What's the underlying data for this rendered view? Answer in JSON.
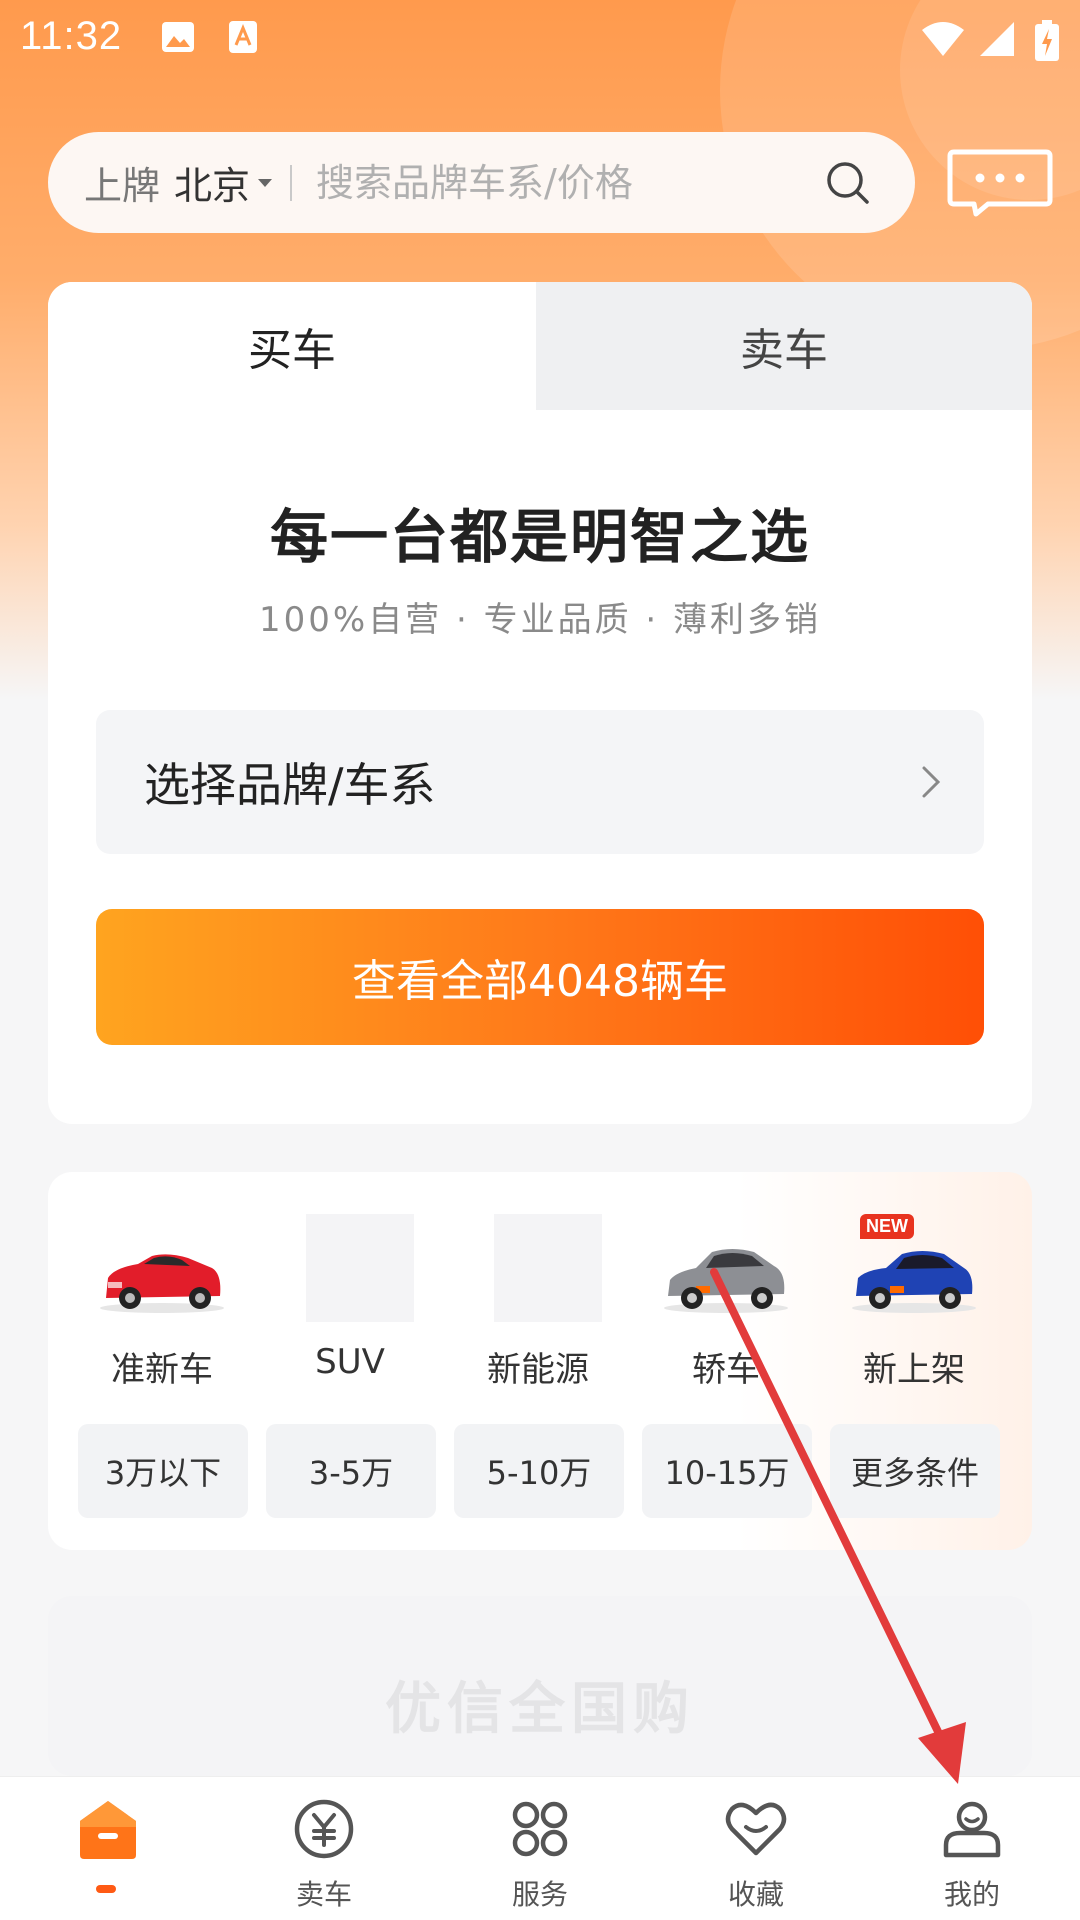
{
  "status_bar": {
    "time": "11:32"
  },
  "search": {
    "prefix": "上牌",
    "city": "北京",
    "placeholder": "搜索品牌车系/价格"
  },
  "tabs": [
    {
      "label": "买车",
      "active": true
    },
    {
      "label": "卖车",
      "active": false
    }
  ],
  "hero": {
    "headline": "每一台都是明智之选",
    "subline": "100%自营 · 专业品质 · 薄利多销"
  },
  "brand_select": {
    "label": "选择品牌/车系"
  },
  "cta": {
    "label": "查看全部4048辆车"
  },
  "categories": [
    {
      "label": "准新车",
      "icon": "red-convertible-car-image"
    },
    {
      "label": "SUV",
      "icon": "placeholder-image"
    },
    {
      "label": "新能源",
      "icon": "placeholder-image"
    },
    {
      "label": "轿车",
      "icon": "silver-sedan-car-image"
    },
    {
      "label": "新上架",
      "icon": "blue-sedan-car-image",
      "badge": "NEW"
    }
  ],
  "price_filters": [
    "3万以下",
    "3-5万",
    "5-10万",
    "10-15万",
    "更多条件"
  ],
  "banner": {
    "text": "优信全国购"
  },
  "bottom_nav": [
    {
      "label": "",
      "icon": "home-icon",
      "active": true
    },
    {
      "label": "卖车",
      "icon": "yuan-coin-icon"
    },
    {
      "label": "服务",
      "icon": "grid-services-icon"
    },
    {
      "label": "收藏",
      "icon": "heart-icon"
    },
    {
      "label": "我的",
      "icon": "profile-icon"
    }
  ],
  "colors": {
    "accent": "#ff5a14",
    "gradient_start": "#ffa41f",
    "gradient_end": "#ff4f06",
    "annotation_arrow": "#e23b3b"
  }
}
